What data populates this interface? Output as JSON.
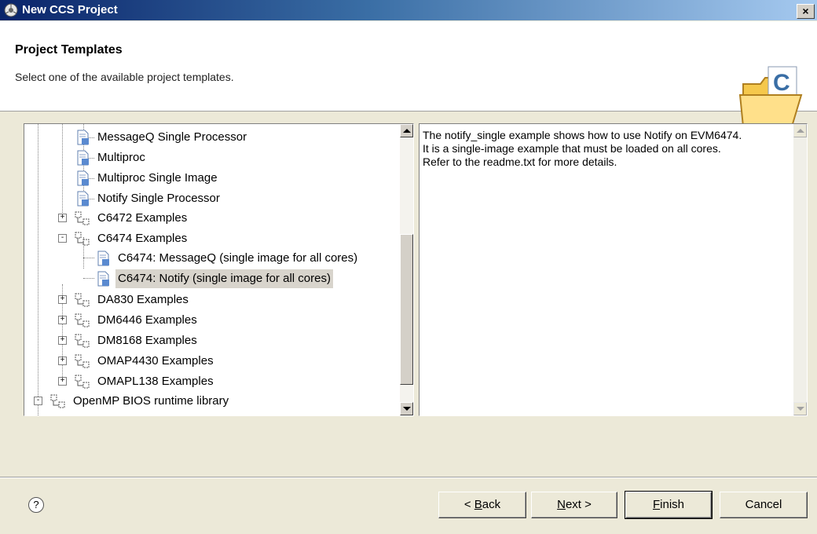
{
  "window": {
    "title": "New CCS Project",
    "close_label": "×"
  },
  "header": {
    "title": "Project Templates",
    "subtitle": "Select one of the available project templates."
  },
  "tree": {
    "items": [
      {
        "label": "MessageQ Single Processor",
        "type": "template"
      },
      {
        "label": "Multiproc",
        "type": "template"
      },
      {
        "label": "Multiproc Single Image",
        "type": "template"
      },
      {
        "label": "Notify Single Processor",
        "type": "template"
      },
      {
        "label": "C6472 Examples",
        "type": "folder",
        "expander": "+"
      },
      {
        "label": "C6474 Examples",
        "type": "folder",
        "expander": "-"
      },
      {
        "label": "C6474: MessageQ (single image for all cores)",
        "type": "template"
      },
      {
        "label": "C6474: Notify (single image for all cores)",
        "type": "template",
        "selected": true
      },
      {
        "label": "DA830 Examples",
        "type": "folder",
        "expander": "+"
      },
      {
        "label": "DM6446 Examples",
        "type": "folder",
        "expander": "+"
      },
      {
        "label": "DM8168 Examples",
        "type": "folder",
        "expander": "+"
      },
      {
        "label": "OMAP4430 Examples",
        "type": "folder",
        "expander": "+"
      },
      {
        "label": "OMAPL138 Examples",
        "type": "folder",
        "expander": "+"
      },
      {
        "label": "OpenMP BIOS runtime library",
        "type": "folder",
        "expander": "-"
      }
    ]
  },
  "description": {
    "lines": [
      "The notify_single example shows how to use Notify on EVM6474.",
      "It is a single-image example that must be loaded on all cores.",
      "Refer to the readme.txt for more details."
    ]
  },
  "footer": {
    "help_label": "?",
    "back": {
      "pre": "< ",
      "mnemonic": "B",
      "post": "ack"
    },
    "next": {
      "pre": "",
      "mnemonic": "N",
      "post": "ext >"
    },
    "finish": {
      "pre": "",
      "mnemonic": "F",
      "post": "inish"
    },
    "cancel_label": "Cancel"
  },
  "colors": {
    "titlebar_start": "#0a246a",
    "titlebar_end": "#a6caf0",
    "dialog_bg": "#ece9d8",
    "selection_bg": "#d8d4cc"
  }
}
